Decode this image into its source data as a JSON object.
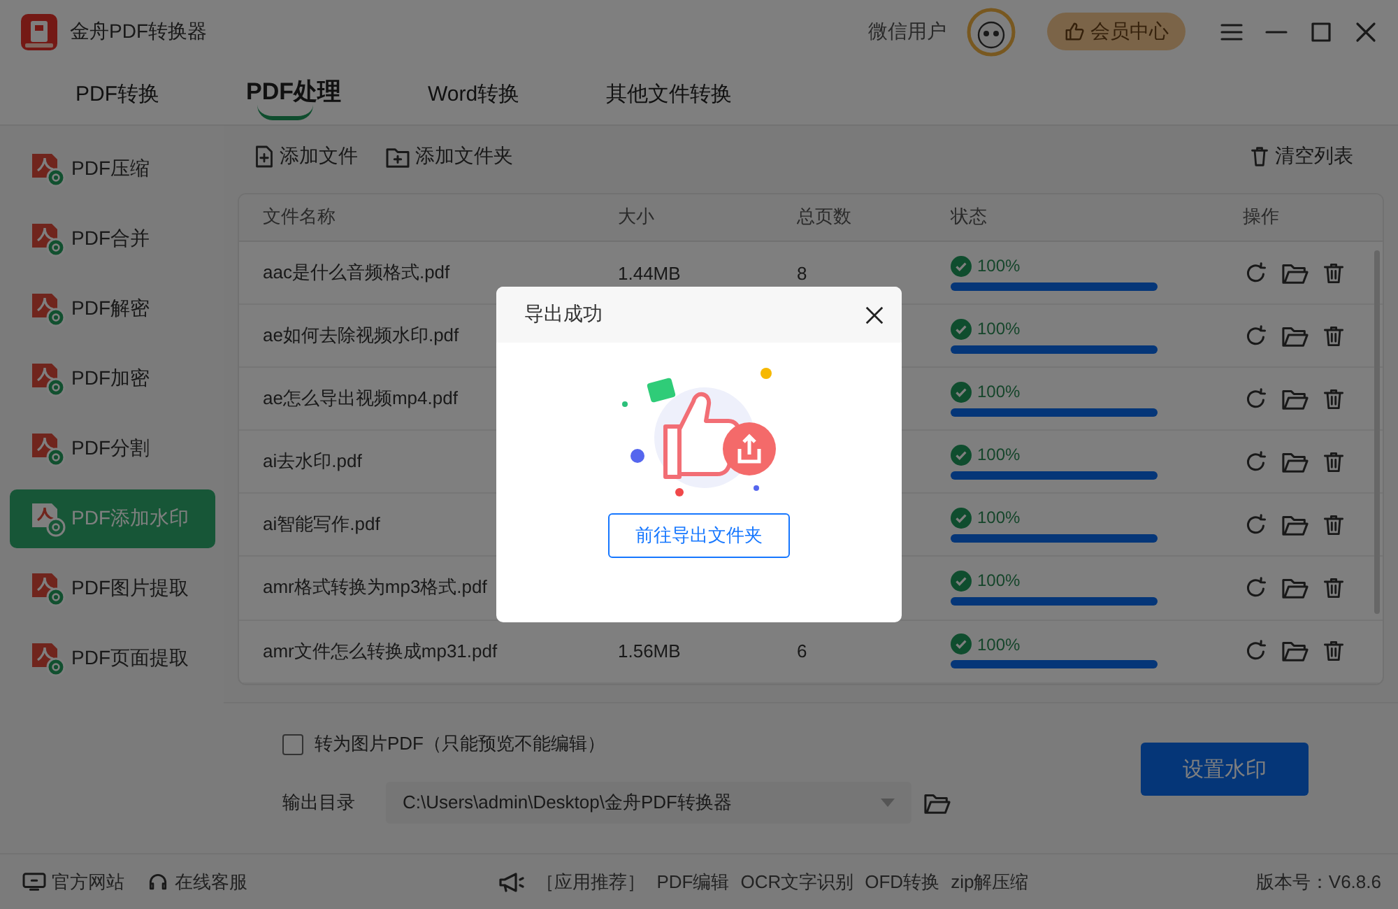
{
  "app": {
    "title": "金舟PDF转换器"
  },
  "user": {
    "name": "微信用户"
  },
  "member_button": "会员中心",
  "tabs": [
    {
      "label": "PDF转换",
      "selected": false
    },
    {
      "label": "PDF处理",
      "selected": true
    },
    {
      "label": "Word转换",
      "selected": false
    },
    {
      "label": "其他文件转换",
      "selected": false
    }
  ],
  "sidebar": {
    "items": [
      {
        "label": "PDF压缩",
        "selected": false
      },
      {
        "label": "PDF合并",
        "selected": false
      },
      {
        "label": "PDF解密",
        "selected": false
      },
      {
        "label": "PDF加密",
        "selected": false
      },
      {
        "label": "PDF分割",
        "selected": false
      },
      {
        "label": "PDF添加水印",
        "selected": true
      },
      {
        "label": "PDF图片提取",
        "selected": false
      },
      {
        "label": "PDF页面提取",
        "selected": false
      }
    ]
  },
  "toolbar": {
    "add_file": "添加文件",
    "add_folder": "添加文件夹",
    "clear_list": "清空列表"
  },
  "table": {
    "columns": [
      "文件名称",
      "大小",
      "总页数",
      "状态",
      "操作"
    ],
    "rows": [
      {
        "name": "aac是什么音频格式.pdf",
        "size": "1.44MB",
        "pages": "8",
        "status": "100%",
        "level": 1
      },
      {
        "name": "ae如何去除视频水印.pdf",
        "status": "100%",
        "level": 1
      },
      {
        "name": "ae怎么导出视频mp4.pdf",
        "status": "100%",
        "level": 1
      },
      {
        "name": "ai去水印.pdf",
        "status": "100%",
        "level": 1
      },
      {
        "name": "ai智能写作.pdf",
        "status": "100%",
        "level": 1
      },
      {
        "name": "amr格式转换为mp3格式.pdf",
        "status": "100%",
        "level": 1
      },
      {
        "name": "amr文件怎么转换成mp31.pdf",
        "size": "1.56MB",
        "pages": "6",
        "status": "100%",
        "level": 1
      }
    ]
  },
  "options": {
    "image_pdf": {
      "label": "转为图片PDF（只能预览不能编辑）",
      "checked": false
    },
    "output_label": "输出目录",
    "output_path": "C:\\Users\\admin\\Desktop\\金舟PDF转换器"
  },
  "primary_button": "设置水印",
  "status_bar": {
    "links": [
      "官方网站",
      "在线客服"
    ],
    "promo_label": "［应用推荐］",
    "promo_links": [
      "PDF编辑",
      "OCR文字识别",
      "OFD转换",
      "zip解压缩"
    ],
    "version": "版本号：V6.8.6"
  },
  "dialog": {
    "title": "导出成功",
    "button": "前往导出文件夹"
  }
}
